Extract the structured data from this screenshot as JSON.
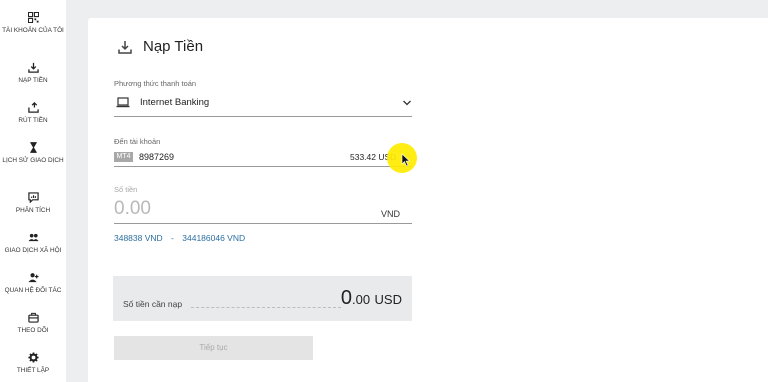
{
  "sidebar": {
    "items": [
      {
        "label": "TÀI KHOẢN CỦA TÔI",
        "icon": "qr-grid-icon"
      },
      {
        "label": "NẠP TIỀN",
        "icon": "download-icon"
      },
      {
        "label": "RÚT TIỀN",
        "icon": "upload-icon"
      },
      {
        "label": "LỊCH SỬ GIAO DỊCH",
        "icon": "hourglass-icon"
      },
      {
        "label": "PHÂN TÍCH",
        "icon": "chat-chart-icon"
      },
      {
        "label": "GIAO DỊCH XÃ HỘI",
        "icon": "group-icon"
      },
      {
        "label": "QUAN HỆ ĐỐI TÁC",
        "icon": "partner-icon"
      },
      {
        "label": "THEO DÕI",
        "icon": "briefcase-icon"
      },
      {
        "label": "THIẾT LẬP",
        "icon": "gear-icon"
      }
    ]
  },
  "page": {
    "title": "Nạp Tiền",
    "title_icon": "download-icon"
  },
  "payment": {
    "label": "Phương thức thanh toán",
    "value": "Internet Banking",
    "icon": "laptop-icon"
  },
  "account": {
    "label": "Đến tài khoản",
    "badge": "MT4",
    "number": "8987269",
    "balance": "533.42 USD"
  },
  "amount": {
    "label": "Số tiền",
    "value": "0.00",
    "currency": "VND",
    "range_min": "348838 VND",
    "range_sep": "-",
    "range_max": "344186046 VND"
  },
  "summary": {
    "label": "Số tiền cần nạp",
    "amount_int": "0",
    "amount_dec": ".00",
    "currency": "USD"
  },
  "actions": {
    "continue_label": "Tiếp tục"
  },
  "colors": {
    "link": "#2c6fa0",
    "cursor_highlight": "#ffec00",
    "background": "#eceeef"
  }
}
